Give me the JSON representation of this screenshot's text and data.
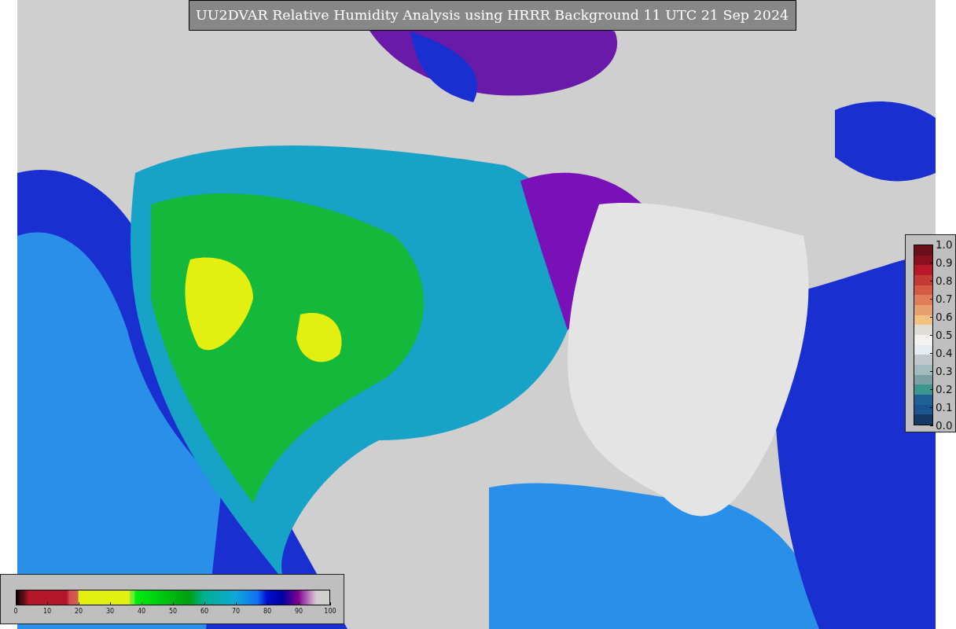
{
  "title": "UU2DVAR Relative Humidity Analysis using HRRR Background 11 UTC 21 Sep 2024",
  "humidity_colorbar": {
    "ticks": [
      "0",
      "10",
      "20",
      "30",
      "40",
      "50",
      "60",
      "70",
      "80",
      "90",
      "100"
    ]
  },
  "station_colorbar": {
    "ticks": [
      "1.0",
      "0.9",
      "0.8",
      "0.7",
      "0.6",
      "0.5",
      "0.4",
      "0.3",
      "0.2",
      "0.1",
      "0.0"
    ]
  }
}
